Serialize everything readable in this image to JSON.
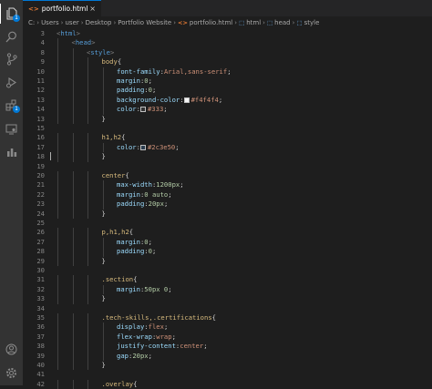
{
  "tab": {
    "filename": "portfolio.html",
    "close": "×"
  },
  "breadcrumb": {
    "path": [
      "C:",
      "Users",
      "user",
      "Desktop",
      "Portfolio Website"
    ],
    "file": "portfolio.html",
    "symbols": [
      "html",
      "head",
      "style"
    ]
  },
  "activity": {
    "explorer_badge": "1",
    "extensions_badge": "1"
  },
  "lines": [
    {
      "n": "3",
      "indent": 0,
      "segs": [
        [
          "<",
          "#808080"
        ],
        [
          "html",
          "#569cd6"
        ],
        [
          ">",
          "#808080"
        ]
      ]
    },
    {
      "n": "4",
      "indent": 1,
      "segs": [
        [
          "<",
          "#808080"
        ],
        [
          "head",
          "#569cd6"
        ],
        [
          ">",
          "#808080"
        ]
      ]
    },
    {
      "n": "8",
      "indent": 2,
      "segs": [
        [
          "<",
          "#808080"
        ],
        [
          "style",
          "#569cd6"
        ],
        [
          ">",
          "#808080"
        ]
      ]
    },
    {
      "n": "9",
      "indent": 3,
      "segs": [
        [
          "body",
          "#d7ba7d"
        ],
        [
          "{",
          "#d4d4d4"
        ]
      ]
    },
    {
      "n": "10",
      "indent": 4,
      "segs": [
        [
          "font-family",
          "#9cdcfe"
        ],
        [
          ":",
          "#d4d4d4"
        ],
        [
          "Arial,sans-serif",
          "#ce9178"
        ],
        [
          ";",
          "#d4d4d4"
        ]
      ]
    },
    {
      "n": "11",
      "indent": 4,
      "segs": [
        [
          "margin",
          "#9cdcfe"
        ],
        [
          ":",
          "#d4d4d4"
        ],
        [
          "0",
          "#b5cea8"
        ],
        [
          ";",
          "#d4d4d4"
        ]
      ]
    },
    {
      "n": "12",
      "indent": 4,
      "segs": [
        [
          "padding",
          "#9cdcfe"
        ],
        [
          ":",
          "#d4d4d4"
        ],
        [
          "0",
          "#b5cea8"
        ],
        [
          ";",
          "#d4d4d4"
        ]
      ]
    },
    {
      "n": "13",
      "indent": 4,
      "segs": [
        [
          "background-color",
          "#9cdcfe"
        ],
        [
          ":",
          "#d4d4d4"
        ],
        [
          "#f4f4f4",
          "#ce9178",
          "#f4f4f4"
        ],
        [
          ";",
          "#d4d4d4"
        ]
      ]
    },
    {
      "n": "14",
      "indent": 4,
      "segs": [
        [
          "color",
          "#9cdcfe"
        ],
        [
          ":",
          "#d4d4d4"
        ],
        [
          "#333",
          "#ce9178",
          "#333333"
        ],
        [
          ";",
          "#d4d4d4"
        ]
      ]
    },
    {
      "n": "13",
      "indent": 3,
      "segs": [
        [
          "}",
          "#d4d4d4"
        ]
      ]
    },
    {
      "n": "15",
      "indent": 0,
      "segs": []
    },
    {
      "n": "16",
      "indent": 3,
      "segs": [
        [
          "h1,h2",
          "#d7ba7d"
        ],
        [
          "{",
          "#d4d4d4"
        ]
      ]
    },
    {
      "n": "17",
      "indent": 4,
      "segs": [
        [
          "color",
          "#9cdcfe"
        ],
        [
          ":",
          "#d4d4d4"
        ],
        [
          "#2c3e50",
          "#ce9178",
          "#2c3e50"
        ],
        [
          ";",
          "#d4d4d4"
        ]
      ]
    },
    {
      "n": "18",
      "indent": 3,
      "segs": [
        [
          "}",
          "#d4d4d4"
        ]
      ]
    },
    {
      "n": "19",
      "indent": 0,
      "segs": []
    },
    {
      "n": "20",
      "indent": 3,
      "segs": [
        [
          "center",
          "#d7ba7d"
        ],
        [
          "{",
          "#d4d4d4"
        ]
      ]
    },
    {
      "n": "21",
      "indent": 4,
      "segs": [
        [
          "max-width",
          "#9cdcfe"
        ],
        [
          ":",
          "#d4d4d4"
        ],
        [
          "1200px",
          "#b5cea8"
        ],
        [
          ";",
          "#d4d4d4"
        ]
      ]
    },
    {
      "n": "22",
      "indent": 4,
      "segs": [
        [
          "margin",
          "#9cdcfe"
        ],
        [
          ":",
          "#d4d4d4"
        ],
        [
          "0 auto",
          "#b5cea8"
        ],
        [
          ";",
          "#d4d4d4"
        ]
      ]
    },
    {
      "n": "23",
      "indent": 4,
      "segs": [
        [
          "padding",
          "#9cdcfe"
        ],
        [
          ":",
          "#d4d4d4"
        ],
        [
          "20px",
          "#b5cea8"
        ],
        [
          ";",
          "#d4d4d4"
        ]
      ]
    },
    {
      "n": "24",
      "indent": 3,
      "segs": [
        [
          "}",
          "#d4d4d4"
        ]
      ]
    },
    {
      "n": "25",
      "indent": 0,
      "segs": []
    },
    {
      "n": "26",
      "indent": 3,
      "segs": [
        [
          "p,h1,h2",
          "#d7ba7d"
        ],
        [
          "{",
          "#d4d4d4"
        ]
      ]
    },
    {
      "n": "27",
      "indent": 4,
      "segs": [
        [
          "margin",
          "#9cdcfe"
        ],
        [
          ":",
          "#d4d4d4"
        ],
        [
          "0",
          "#b5cea8"
        ],
        [
          ";",
          "#d4d4d4"
        ]
      ]
    },
    {
      "n": "28",
      "indent": 4,
      "segs": [
        [
          "padding",
          "#9cdcfe"
        ],
        [
          ":",
          "#d4d4d4"
        ],
        [
          "0",
          "#b5cea8"
        ],
        [
          ";",
          "#d4d4d4"
        ]
      ]
    },
    {
      "n": "29",
      "indent": 3,
      "segs": [
        [
          "}",
          "#d4d4d4"
        ]
      ]
    },
    {
      "n": "30",
      "indent": 0,
      "segs": []
    },
    {
      "n": "31",
      "indent": 3,
      "segs": [
        [
          ".section",
          "#d7ba7d"
        ],
        [
          "{",
          "#d4d4d4"
        ]
      ]
    },
    {
      "n": "32",
      "indent": 4,
      "segs": [
        [
          "margin",
          "#9cdcfe"
        ],
        [
          ":",
          "#d4d4d4"
        ],
        [
          "50px 0",
          "#b5cea8"
        ],
        [
          ";",
          "#d4d4d4"
        ]
      ]
    },
    {
      "n": "33",
      "indent": 3,
      "segs": [
        [
          "}",
          "#d4d4d4"
        ]
      ]
    },
    {
      "n": "34",
      "indent": 0,
      "segs": []
    },
    {
      "n": "35",
      "indent": 3,
      "segs": [
        [
          ".tech-skills,.certifications",
          "#d7ba7d"
        ],
        [
          "{",
          "#d4d4d4"
        ]
      ]
    },
    {
      "n": "36",
      "indent": 4,
      "segs": [
        [
          "display",
          "#9cdcfe"
        ],
        [
          ":",
          "#d4d4d4"
        ],
        [
          "flex",
          "#ce9178"
        ],
        [
          ";",
          "#d4d4d4"
        ]
      ]
    },
    {
      "n": "37",
      "indent": 4,
      "segs": [
        [
          "flex-wrap",
          "#9cdcfe"
        ],
        [
          ":",
          "#d4d4d4"
        ],
        [
          "wrap",
          "#ce9178"
        ],
        [
          ";",
          "#d4d4d4"
        ]
      ]
    },
    {
      "n": "38",
      "indent": 4,
      "segs": [
        [
          "justify-content",
          "#9cdcfe"
        ],
        [
          ":",
          "#d4d4d4"
        ],
        [
          "center",
          "#ce9178"
        ],
        [
          ";",
          "#d4d4d4"
        ]
      ]
    },
    {
      "n": "39",
      "indent": 4,
      "segs": [
        [
          "gap",
          "#9cdcfe"
        ],
        [
          ":",
          "#d4d4d4"
        ],
        [
          "20px",
          "#b5cea8"
        ],
        [
          ";",
          "#d4d4d4"
        ]
      ]
    },
    {
      "n": "40",
      "indent": 3,
      "segs": [
        [
          "}",
          "#d4d4d4"
        ]
      ]
    },
    {
      "n": "41",
      "indent": 0,
      "segs": []
    },
    {
      "n": "42",
      "indent": 3,
      "segs": [
        [
          ".overlay",
          "#d7ba7d"
        ],
        [
          "{",
          "#d4d4d4"
        ]
      ]
    }
  ]
}
